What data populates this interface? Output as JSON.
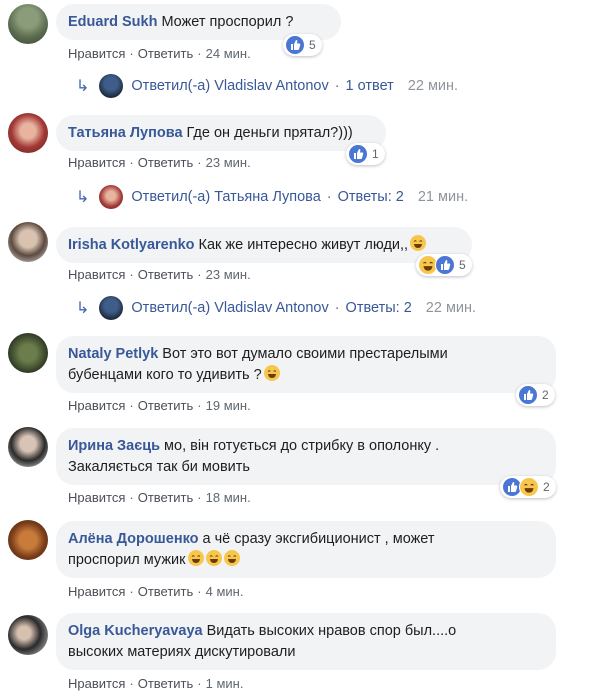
{
  "comments": [
    {
      "name": "Eduard Sukh",
      "text": "Может проспорил ?",
      "like": "Нравится",
      "reply": "Ответить",
      "time": "24 мин.",
      "reactions": "5"
    },
    {
      "name": "Татьяна Лупова",
      "text": "Где он деньги прятал?)))",
      "like": "Нравится",
      "reply": "Ответить",
      "time": "23 мин.",
      "reactions": "1"
    },
    {
      "name": "Irisha Kotlyarenko",
      "text": "Как же интересно живут люди,,",
      "like": "Нравится",
      "reply": "Ответить",
      "time": "23 мин.",
      "reactions": "5"
    },
    {
      "name": "Nataly Petlyk",
      "text_line1": "Вот это вот думало своими престарелыми",
      "text_line2": "бубенцами кого то удивить ?",
      "like": "Нравится",
      "reply": "Ответить",
      "time": "19 мин.",
      "reactions": "2"
    },
    {
      "name": "Ирина Заєць",
      "text_line1": "мо, він готується до стрибку в ополонку .",
      "text_line2": "Закаляється так би мовить",
      "like": "Нравится",
      "reply": "Ответить",
      "time": "18 мин.",
      "reactions": "2"
    },
    {
      "name": "Алёна Дорошенко",
      "text_line1": "а чё сразу эксгибиционист , может",
      "text_line2": "проспорил мужик",
      "like": "Нравится",
      "reply": "Ответить",
      "time": "4 мин."
    },
    {
      "name": "Olga Kucheryavaya",
      "text_line1": "Видать высоких нравов спор был....о",
      "text_line2": "высоких материях дискутировали",
      "like": "Нравится",
      "reply": "Ответить",
      "time": "1 мин."
    }
  ],
  "replies": [
    {
      "who": "Ответил(-а) Vladislav Antonov",
      "count": "1 ответ",
      "time": "22 мин."
    },
    {
      "who": "Ответил(-а) Татьяна Лупова",
      "count": "Ответы: 2",
      "time": "21 мин."
    },
    {
      "who": "Ответил(-а) Vladislav Antonov",
      "count": "Ответы: 2",
      "time": "22 мин."
    }
  ]
}
